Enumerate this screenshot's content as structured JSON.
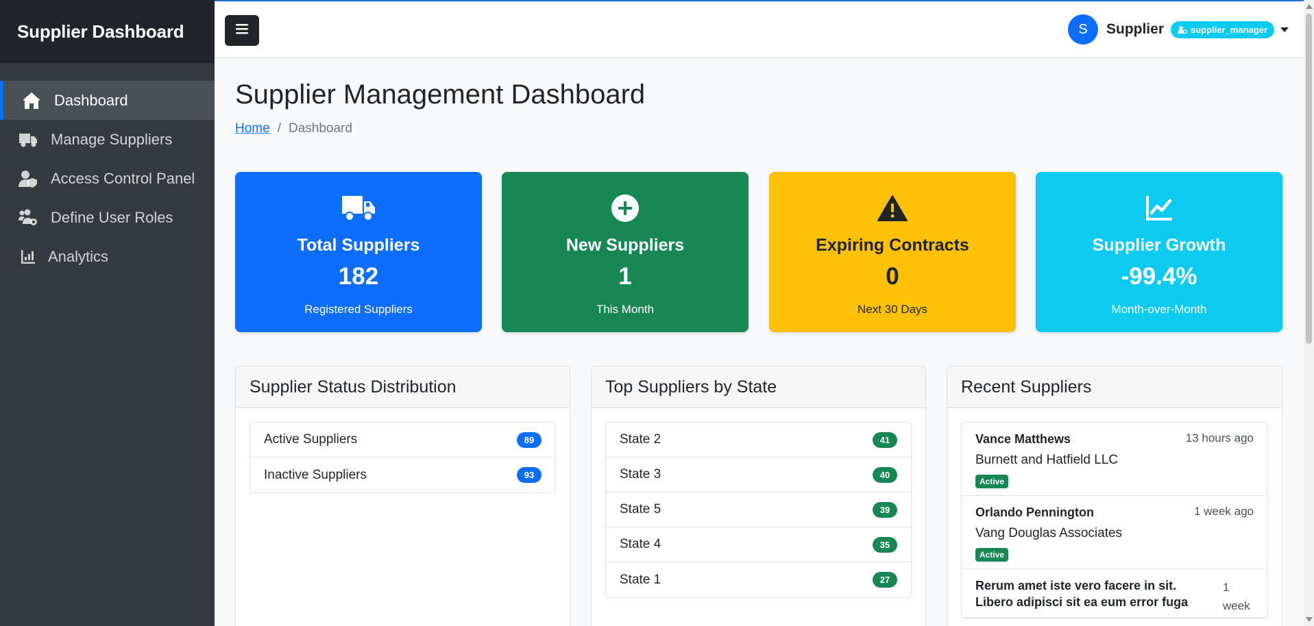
{
  "sidebar": {
    "brand": "Supplier Dashboard",
    "items": [
      {
        "label": "Dashboard",
        "icon": "home-icon",
        "active": true
      },
      {
        "label": "Manage Suppliers",
        "icon": "truck-icon"
      },
      {
        "label": "Access Control Panel",
        "icon": "user-shield-icon"
      },
      {
        "label": "Define User Roles",
        "icon": "users-cog-icon"
      },
      {
        "label": "Analytics",
        "icon": "chart-bar-icon"
      }
    ]
  },
  "topbar": {
    "toggle_icon": "hamburger-icon",
    "avatar_initial": "S",
    "user_name": "Supplier",
    "role": "supplier_manager"
  },
  "page": {
    "title": "Supplier Management Dashboard",
    "breadcrumb": {
      "home": "Home",
      "separator": "/",
      "current": "Dashboard"
    }
  },
  "stats": [
    {
      "title": "Total Suppliers",
      "value": "182",
      "sub": "Registered Suppliers",
      "color": "#0d6efd",
      "icon": "truck-icon"
    },
    {
      "title": "New Suppliers",
      "value": "1",
      "sub": "This Month",
      "color": "#198754",
      "icon": "plus-circle-icon"
    },
    {
      "title": "Expiring Contracts",
      "value": "0",
      "sub": "Next 30 Days",
      "color": "#ffc107",
      "icon": "warning-icon"
    },
    {
      "title": "Supplier Growth",
      "value": "-99.4%",
      "sub": "Month-over-Month",
      "color": "#0dcaf0",
      "icon": "chart-line-icon"
    }
  ],
  "status_panel": {
    "title": "Supplier Status Distribution",
    "rows": [
      {
        "label": "Active Suppliers",
        "count": "89"
      },
      {
        "label": "Inactive Suppliers",
        "count": "93"
      }
    ]
  },
  "state_panel": {
    "title": "Top Suppliers by State",
    "rows": [
      {
        "label": "State 2",
        "count": "41"
      },
      {
        "label": "State 3",
        "count": "40"
      },
      {
        "label": "State 5",
        "count": "39"
      },
      {
        "label": "State 4",
        "count": "35"
      },
      {
        "label": "State 1",
        "count": "27"
      }
    ]
  },
  "recent_panel": {
    "title": "Recent Suppliers",
    "items": [
      {
        "name": "Vance Matthews",
        "time": "13 hours ago",
        "company": "Burnett and Hatfield LLC",
        "status": "Active"
      },
      {
        "name": "Orlando Pennington",
        "time": "1 week ago",
        "company": "Vang Douglas Associates",
        "status": "Active"
      },
      {
        "name": "Rerum amet iste vero facere in sit. Libero adipisci sit ea eum error fuga",
        "time": "1 week",
        "company": "",
        "status": ""
      }
    ]
  }
}
